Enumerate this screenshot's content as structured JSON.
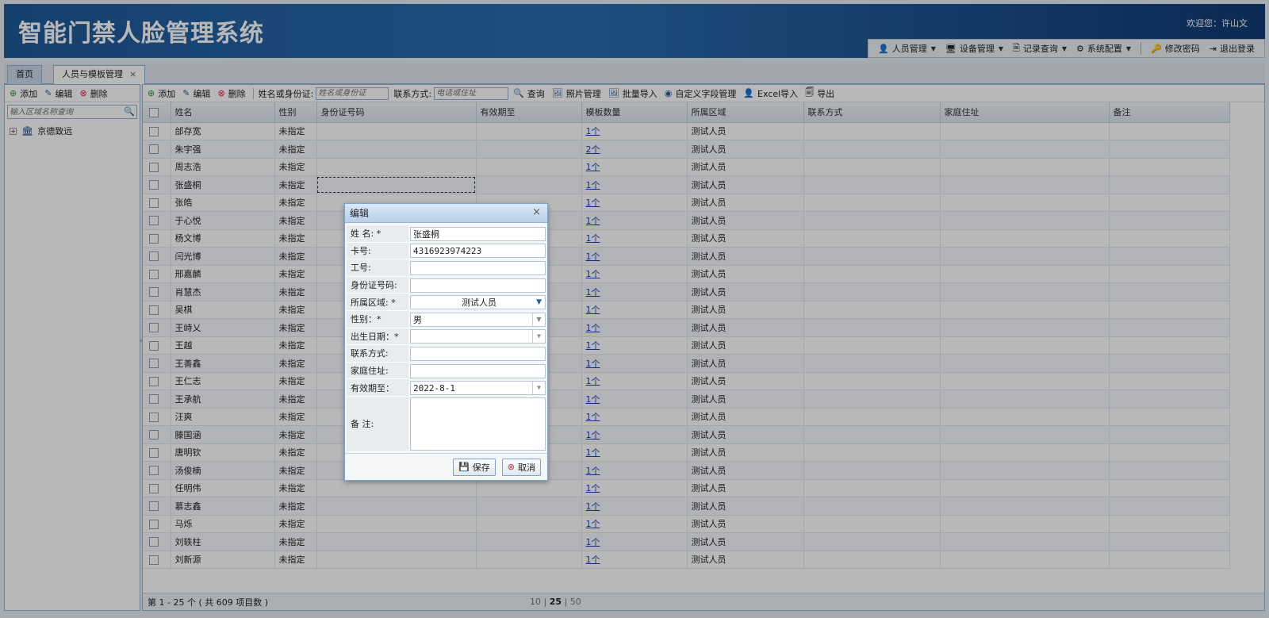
{
  "header": {
    "title": "智能门禁人脸管理系统",
    "welcome": "欢迎您：许山文"
  },
  "topnav": {
    "items": [
      {
        "label": "人员管理",
        "icon": "person-icon"
      },
      {
        "label": "设备管理",
        "icon": "monitor-icon"
      },
      {
        "label": "记录查询",
        "icon": "record-icon"
      },
      {
        "label": "系统配置",
        "icon": "gear-icon"
      }
    ],
    "change_password": "修改密码",
    "logout": "退出登录"
  },
  "tabs": [
    {
      "label": "首页"
    },
    {
      "label": "人员与模板管理"
    }
  ],
  "left": {
    "add": "添加",
    "edit": "编辑",
    "delete": "删除",
    "search_placeholder": "输入区域名称查询",
    "tree_root": "京德致远"
  },
  "toolbar": {
    "add": "添加",
    "edit": "编辑",
    "delete": "删除",
    "name_label": "姓名或身份证:",
    "name_placeholder": "姓名或身份证",
    "contact_label": "联系方式:",
    "contact_placeholder": "电话或住址",
    "query": "查询",
    "photo": "照片管理",
    "batch_import": "批量导入",
    "custom_field": "自定义字段管理",
    "excel_import": "Excel导入",
    "export": "导出"
  },
  "grid": {
    "columns": [
      "姓名",
      "性别",
      "身份证号码",
      "有效期至",
      "模板数量",
      "所属区域",
      "联系方式",
      "家庭住址",
      "备注"
    ],
    "rows": [
      {
        "name": "邰存宽",
        "gender": "未指定",
        "templates": "1个",
        "area": "测试人员"
      },
      {
        "name": "朱宇强",
        "gender": "未指定",
        "templates": "2个",
        "area": "测试人员"
      },
      {
        "name": "周志浩",
        "gender": "未指定",
        "templates": "1个",
        "area": "测试人员"
      },
      {
        "name": "张盛桐",
        "gender": "未指定",
        "templates": "1个",
        "area": "测试人员"
      },
      {
        "name": "张皓",
        "gender": "未指定",
        "templates": "1个",
        "area": "测试人员"
      },
      {
        "name": "于心悦",
        "gender": "未指定",
        "templates": "1个",
        "area": "测试人员"
      },
      {
        "name": "杨文博",
        "gender": "未指定",
        "templates": "1个",
        "area": "测试人员"
      },
      {
        "name": "闫光博",
        "gender": "未指定",
        "templates": "1个",
        "area": "测试人员"
      },
      {
        "name": "邢嘉麟",
        "gender": "未指定",
        "templates": "1个",
        "area": "测试人员"
      },
      {
        "name": "肖慧杰",
        "gender": "未指定",
        "templates": "1个",
        "area": "测试人员"
      },
      {
        "name": "吴棋",
        "gender": "未指定",
        "templates": "1个",
        "area": "测试人员"
      },
      {
        "name": "王峙乂",
        "gender": "未指定",
        "templates": "1个",
        "area": "测试人员"
      },
      {
        "name": "王越",
        "gender": "未指定",
        "templates": "1个",
        "area": "测试人员"
      },
      {
        "name": "王善鑫",
        "gender": "未指定",
        "templates": "1个",
        "area": "测试人员"
      },
      {
        "name": "王仁志",
        "gender": "未指定",
        "templates": "1个",
        "area": "测试人员"
      },
      {
        "name": "王承航",
        "gender": "未指定",
        "templates": "1个",
        "area": "测试人员"
      },
      {
        "name": "汪爽",
        "gender": "未指定",
        "templates": "1个",
        "area": "测试人员"
      },
      {
        "name": "滕国涵",
        "gender": "未指定",
        "templates": "1个",
        "area": "测试人员"
      },
      {
        "name": "唐明钦",
        "gender": "未指定",
        "templates": "1个",
        "area": "测试人员"
      },
      {
        "name": "汤俊楠",
        "gender": "未指定",
        "templates": "1个",
        "area": "测试人员"
      },
      {
        "name": "任明伟",
        "gender": "未指定",
        "templates": "1个",
        "area": "测试人员"
      },
      {
        "name": "慕志鑫",
        "gender": "未指定",
        "templates": "1个",
        "area": "测试人员"
      },
      {
        "name": "马烁",
        "gender": "未指定",
        "templates": "1个",
        "area": "测试人员"
      },
      {
        "name": "刘轶柱",
        "gender": "未指定",
        "templates": "1个",
        "area": "测试人员"
      },
      {
        "name": "刘新源",
        "gender": "未指定",
        "templates": "1个",
        "area": "测试人员"
      }
    ]
  },
  "pager": {
    "info": "第 1 - 25 个 ( 共 609 项目数 )",
    "size1": "10",
    "size2": "25",
    "size3": "50"
  },
  "dialog": {
    "title": "编辑",
    "fields": {
      "name_label": "姓  名: *",
      "name": "张盛桐",
      "card_label": "卡号:",
      "card": "4316923974223",
      "job_label": "工号:",
      "id_label": "身份证号码:",
      "area_label": "所属区域: *",
      "area": "测试人员",
      "gender_label": "性别：*",
      "gender": "男",
      "birth_label": "出生日期：*",
      "contact_label": "联系方式:",
      "address_label": "家庭住址:",
      "expire_label": "有效期至：",
      "expire": "2022-8-1",
      "remark_label": "备  注:"
    },
    "save": "保存",
    "cancel": "取消"
  }
}
